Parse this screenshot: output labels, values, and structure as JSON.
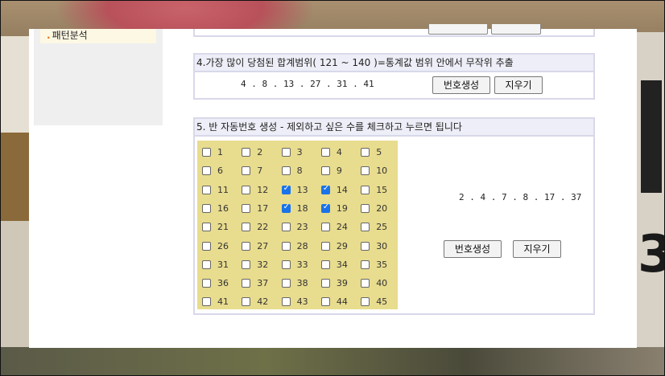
{
  "sidebar": {
    "item_label": "패턴분석",
    "bullet": "."
  },
  "section4": {
    "title": "4.가장 많이 당첨된 합계범위( 121 ~ 140 )=통계값 범위 안에서 무작위 추출",
    "numbers": "4 . 8 . 13 . 27 . 31 . 41",
    "generate_label": "번호생성",
    "clear_label": "지우기"
  },
  "section5": {
    "title": "5. 반 자동번호 생성 - 제외하고 싶은 수를 체크하고 누르면 됩니다",
    "numbers": "2 . 4 . 7 . 8 . 17 . 37",
    "generate_label": "번호생성",
    "clear_label": "지우기",
    "checked": [
      13,
      14,
      18,
      19
    ],
    "grid_color": "#e8dc8e",
    "check_color": "#1a73e8"
  }
}
